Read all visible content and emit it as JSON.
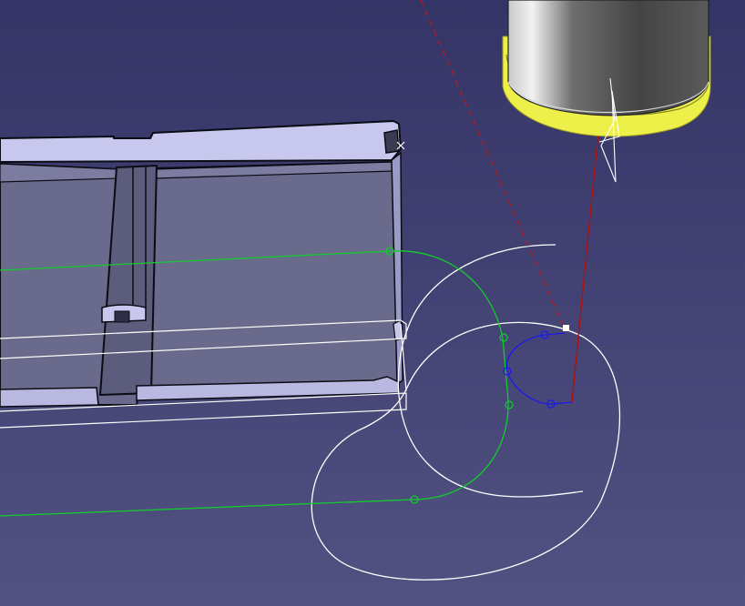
{
  "viewport": {
    "background_top": "#353466",
    "background_bottom": "#515182"
  },
  "colors": {
    "part_face": "#6a6a8c",
    "part_top": "#c8c8ee",
    "part_edge": "#0b0b14",
    "tool_body": "#4a4a4a",
    "tool_highlight": "#ececec",
    "tool_selection": "#eef04a",
    "curve_white": "#ffffff",
    "curve_green": "#12cc2c",
    "curve_blue": "#1a1aee",
    "axis_red": "#b01010",
    "dashed_red": "#b81a1a"
  },
  "icons": {
    "anchor_marker": "white-square-icon",
    "corner_marker": "cross-marker-icon"
  }
}
